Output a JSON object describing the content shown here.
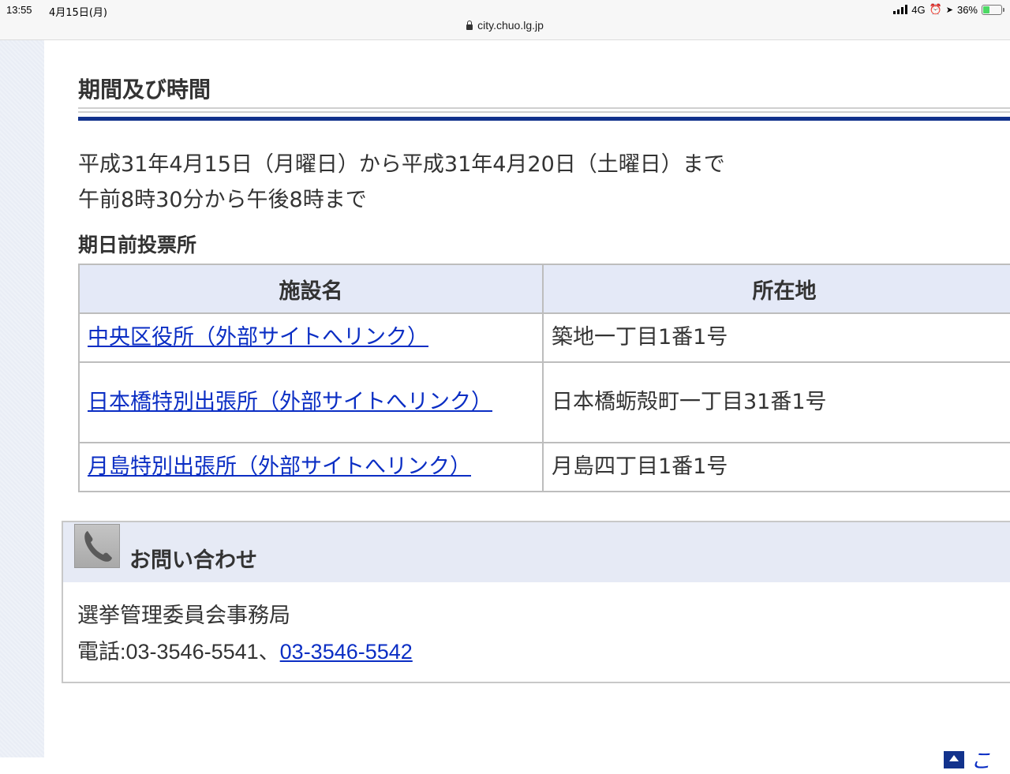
{
  "status_bar": {
    "time": "13:55",
    "date": "4月15日(月)",
    "network": "4G",
    "battery": "36%",
    "battery_level": 0.36
  },
  "browser": {
    "url": "city.chuo.lg.jp"
  },
  "section": {
    "title": "期間及び時間",
    "period_line1": "平成31年4月15日（月曜日）から平成31年4月20日（土曜日）まで",
    "period_line2": "午前8時30分から午後8時まで"
  },
  "venues": {
    "title": "期日前投票所",
    "headers": {
      "name": "施設名",
      "location": "所在地"
    },
    "rows": [
      {
        "name": "中央区役所（外部サイトへリンク）",
        "address": "築地一丁目1番1号"
      },
      {
        "name": "日本橋特別出張所（外部サイトへリンク）",
        "address": "日本橋蛎殻町一丁目31番1号"
      },
      {
        "name": "月島特別出張所（外部サイトへリンク）",
        "address": "月島四丁目1番1号"
      }
    ]
  },
  "contact": {
    "title": "お問い合わせ",
    "office": "選挙管理委員会事務局",
    "phone_label": "電話:03-3546-5541、",
    "phone_link": "03-3546-5542"
  },
  "page_top": {
    "label": "こ"
  },
  "colors": {
    "link": "#0b2ec4",
    "accent_rule": "#12328c",
    "table_header_bg": "#e4e9f7",
    "contact_header_bg": "#e6eaf5"
  }
}
